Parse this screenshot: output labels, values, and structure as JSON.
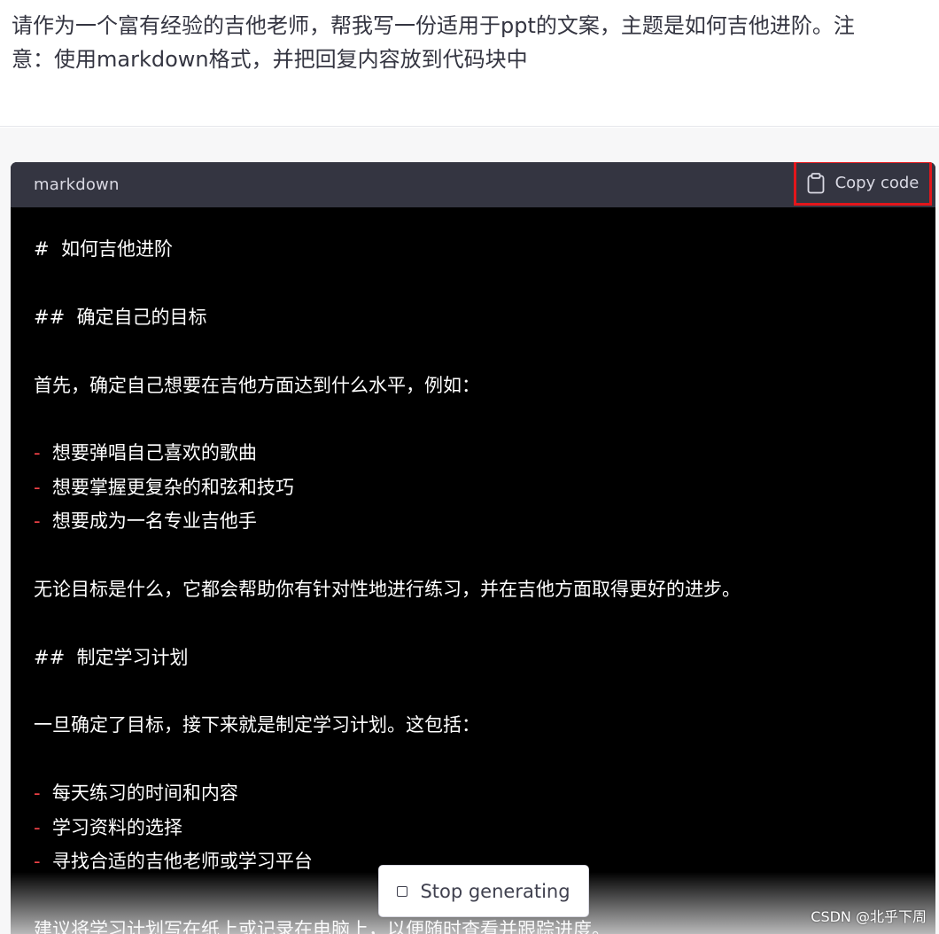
{
  "user_message": {
    "line1": "请作为一个富有经验的吉他老师，帮我写一份适用于ppt的文案，主题是如何吉他进阶。注",
    "line2": "意：使用markdown格式，并把回复内容放到代码块中"
  },
  "code_block": {
    "language": "markdown",
    "copy_label": "Copy code",
    "lines": [
      "#  如何吉他进阶",
      "",
      "##  确定自己的目标",
      "",
      "首先，确定自己想要在吉他方面达到什么水平，例如：",
      "",
      "-  想要弹唱自己喜欢的歌曲",
      "-  想要掌握更复杂的和弦和技巧",
      "-  想要成为一名专业吉他手",
      "",
      "无论目标是什么，它都会帮助你有针对性地进行练习，并在吉他方面取得更好的进步。",
      "",
      "##  制定学习计划",
      "",
      "一旦确定了目标，接下来就是制定学习计划。这包括：",
      "",
      "-  每天练习的时间和内容",
      "-  学习资料的选择",
      "-  寻找合适的吉他老师或学习平台",
      "",
      "建议将学习计划写在纸上或记录在电脑上，以便随时查看并跟踪进度。"
    ]
  },
  "stop_button": {
    "label": "Stop generating"
  },
  "watermark": "CSDN @北乎下周",
  "colors": {
    "code_header_bg": "#343541",
    "code_body_bg": "#000000",
    "bullet": "#ef4146",
    "highlight_border": "#e3161b",
    "assistant_bg": "#f7f7f8"
  }
}
